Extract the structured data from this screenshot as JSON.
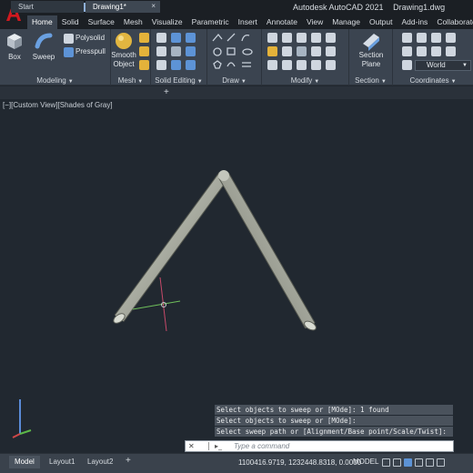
{
  "app": {
    "product": "Autodesk AutoCAD 2021",
    "document": "Drawing1.dwg",
    "logo_letter": "A"
  },
  "ribbon_tabs": [
    "Home",
    "Solid",
    "Surface",
    "Mesh",
    "Visualize",
    "Parametric",
    "Insert",
    "Annotate",
    "View",
    "Manage",
    "Output",
    "Add-ins",
    "Collaborate"
  ],
  "ribbon_active_tab": "Home",
  "ribbon": {
    "modeling": {
      "label": "Modeling",
      "box": "Box",
      "sweep": "Sweep",
      "polysolid": "Polysolid",
      "presspull": "Presspull"
    },
    "mesh": {
      "label": "Mesh",
      "smooth_line1": "Smooth",
      "smooth_line2": "Object"
    },
    "solid_editing": {
      "label": "Solid Editing"
    },
    "draw": {
      "label": "Draw"
    },
    "modify": {
      "label": "Modify"
    },
    "section": {
      "label": "Section",
      "plane_line1": "Section",
      "plane_line2": "Plane"
    },
    "coordinates": {
      "label": "Coordinates",
      "ucs_value": "World"
    }
  },
  "doc_tabs": {
    "start": "Start",
    "drawing": "Drawing1*",
    "plus": "+"
  },
  "viewport": {
    "label": "[−][Custom View][Shades of Gray]",
    "background_color": "#212830",
    "pipe_color": "#b9bcb2"
  },
  "command": {
    "history": [
      "Select objects to sweep or [MOde]: 1 found",
      "Select objects to sweep or [MOde]:",
      "Select sweep path or [Alignment/Base point/Scale/Twist]:"
    ],
    "placeholder": "Type a command"
  },
  "status": {
    "layout_tabs": [
      "Model",
      "Layout1",
      "Layout2"
    ],
    "plus": "+",
    "coordinates": "1100416.9719, 1232448.8318, 0.0000",
    "mode": "MODEL"
  }
}
